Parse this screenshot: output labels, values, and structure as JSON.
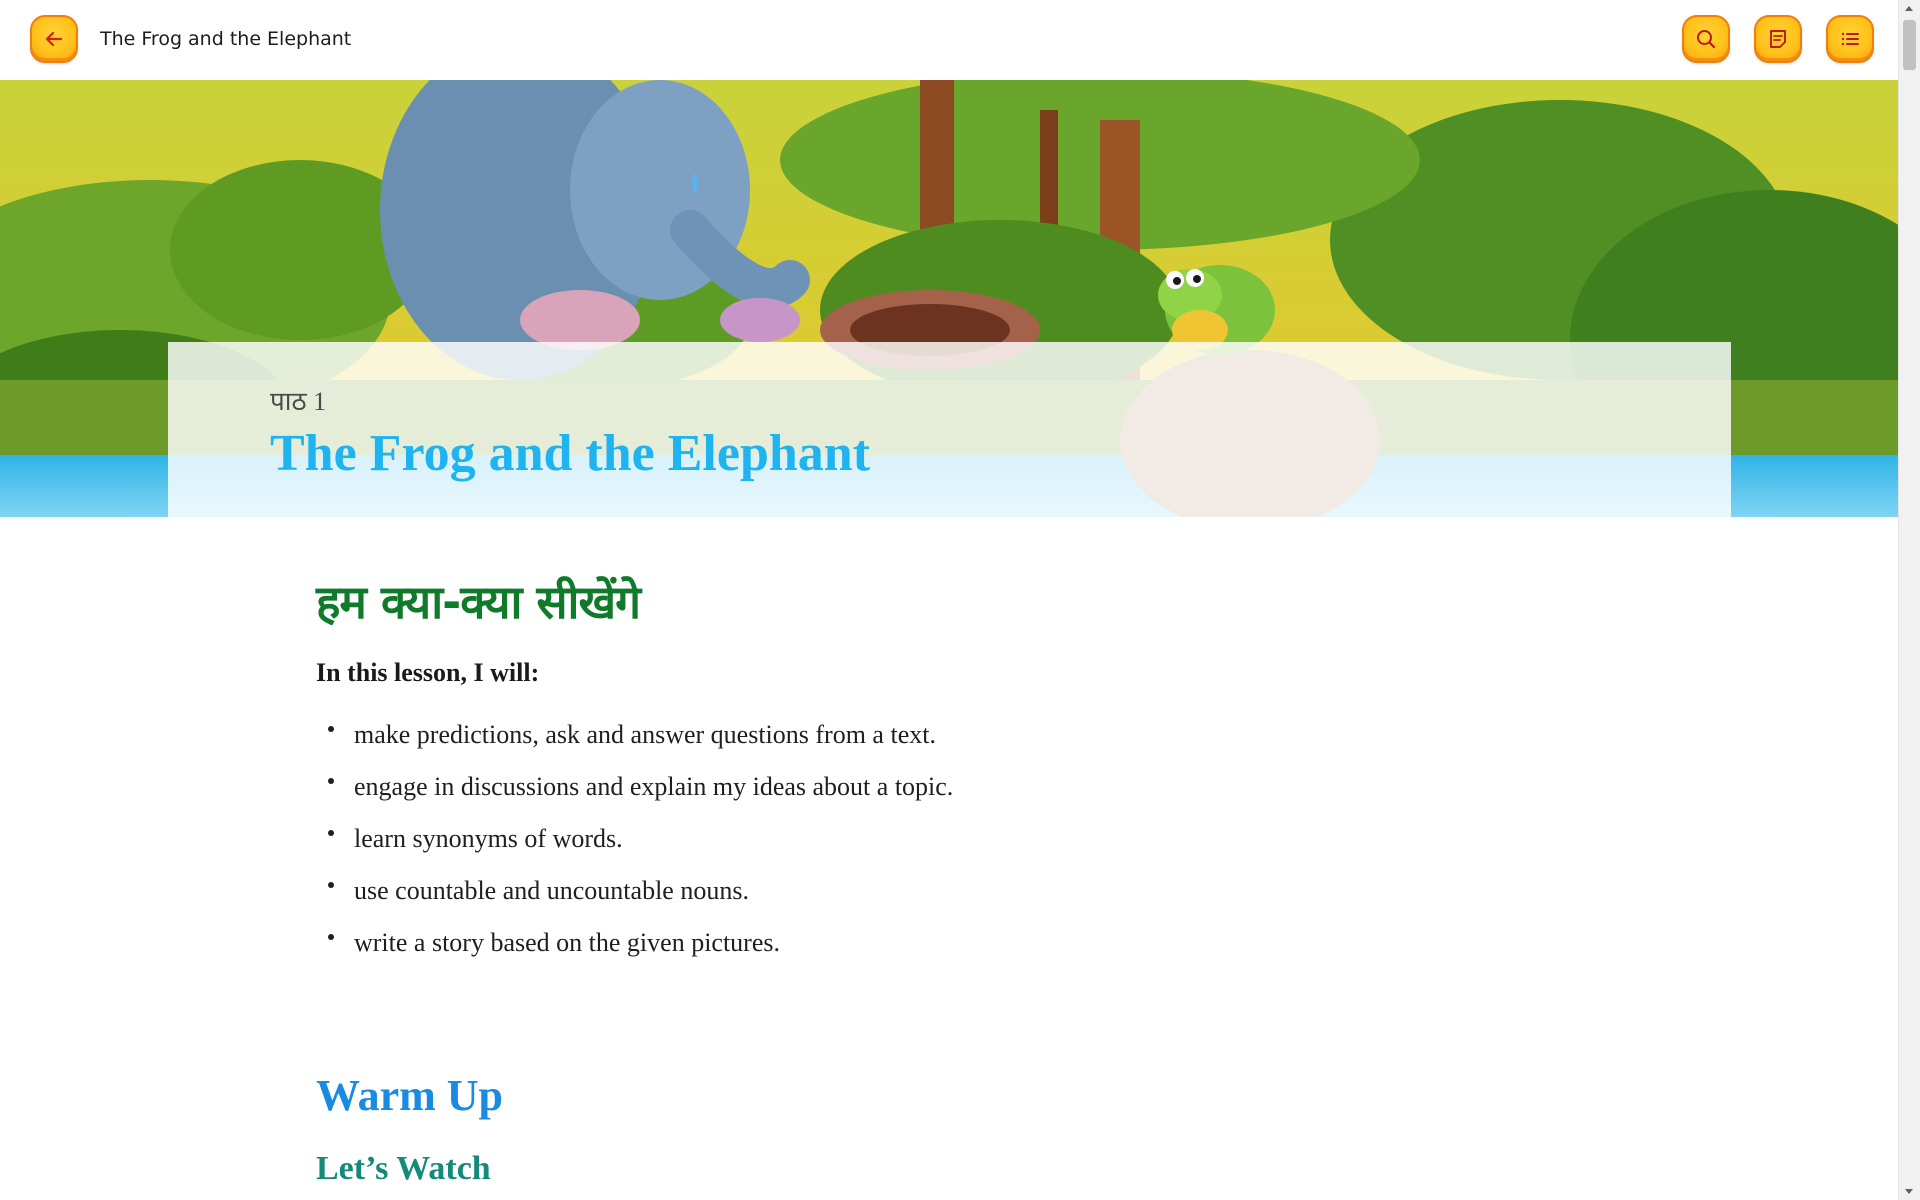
{
  "header": {
    "title": "The Frog and the Elephant",
    "back_icon": "arrow-left-icon",
    "actions": [
      {
        "name": "search",
        "icon": "search-icon"
      },
      {
        "name": "notes",
        "icon": "notes-icon"
      },
      {
        "name": "contents",
        "icon": "list-icon"
      }
    ],
    "accent_color": "#ffc21a"
  },
  "hero": {
    "lesson_number": "पाठ 1",
    "lesson_title": "The Frog and the Elephant"
  },
  "content": {
    "hindi_heading": "हम क्या-क्या सीखेंगे",
    "intro": "In this lesson, I will:",
    "objectives": [
      "make predictions, ask and answer questions from a text.",
      "engage in discussions and explain my ideas about a topic.",
      "learn synonyms of words.",
      "use countable and uncountable nouns.",
      "write a story based on the given pictures."
    ],
    "section_heading": "Warm Up",
    "subsection_heading": "Let’s Watch"
  }
}
